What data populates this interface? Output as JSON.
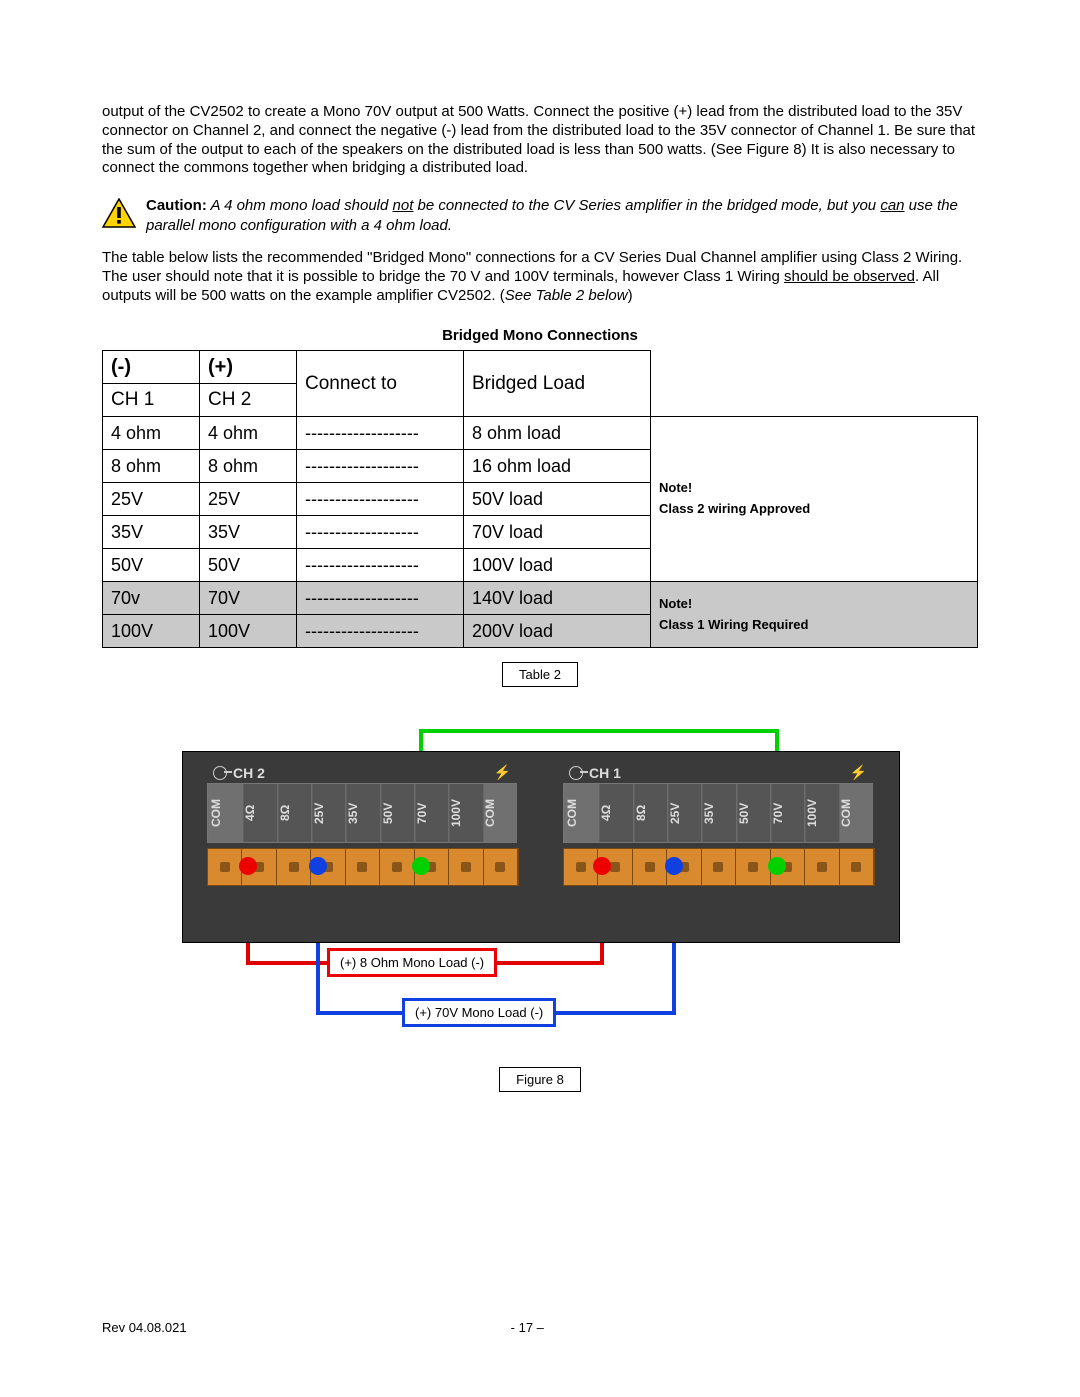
{
  "para1": "output of the CV2502 to create a Mono 70V output at 500 Watts.  Connect the positive (+) lead from the distributed load to the 35V connector on Channel 2, and connect the negative (-) lead from the distributed load to the 35V connector of Channel 1. Be sure that the sum of the output to each of the speakers on the distributed load is less than 500 watts.  (See Figure 8)  It is also necessary to connect the commons together when bridging a distributed load.",
  "caution_label": "Caution:",
  "caution_body_1": "A 4 ohm mono load should ",
  "caution_not": "not",
  "caution_body_2": " be connected to the CV Series amplifier in the bridged mode, but you ",
  "caution_can": "can",
  "caution_body_3": " use the parallel mono configuration with a 4 ohm load.",
  "para2_a": "The table below lists the recommended \"Bridged Mono\" connections for a CV Series Dual Channel amplifier using Class 2 Wiring.  The user should note that it is possible to bridge the 70 V and 100V terminals, however Class 1 Wiring ",
  "para2_u": "should be observed",
  "para2_b": ".  All outputs will be 500 watts on the example amplifier CV2502. (",
  "para2_i": "See Table 2 below",
  "para2_c": ")",
  "table_title": "Bridged Mono Connections",
  "headers": {
    "neg": "(-)",
    "pos": "(+)",
    "ch1": "CH 1",
    "ch2": "CH 2",
    "connect": "Connect to",
    "load": "Bridged Load"
  },
  "rows": [
    {
      "ch1": "4 ohm",
      "ch2": "4 ohm",
      "conn": "-------------------",
      "load": "8 ohm load",
      "group": "c2"
    },
    {
      "ch1": "8 ohm",
      "ch2": "8 ohm",
      "conn": "-------------------",
      "load": "16 ohm load",
      "group": "c2"
    },
    {
      "ch1": "25V",
      "ch2": "25V",
      "conn": "-------------------",
      "load": "50V load",
      "group": "c2"
    },
    {
      "ch1": "35V",
      "ch2": "35V",
      "conn": "-------------------",
      "load": "70V load",
      "group": "c2"
    },
    {
      "ch1": "50V",
      "ch2": "50V",
      "conn": "-------------------",
      "load": "100V load",
      "group": "c2"
    },
    {
      "ch1": "70v",
      "ch2": "70V",
      "conn": "-------------------",
      "load": "140V load",
      "group": "c1"
    },
    {
      "ch1": "100V",
      "ch2": "100V",
      "conn": "-------------------",
      "load": "200V load",
      "group": "c1"
    }
  ],
  "note_c2_a": "Note!",
  "note_c2_b": "Class 2 wiring Approved",
  "note_c1_a": "Note!",
  "note_c1_b": "Class 1 Wiring Required",
  "caption_table": "Table 2",
  "caption_figure": "Figure 8",
  "figure": {
    "ch2_label": "CH 2",
    "ch1_label": "CH 1",
    "terminals": [
      "COM",
      "4Ω",
      "8Ω",
      "25V",
      "35V",
      "50V",
      "70V",
      "100V",
      "COM"
    ],
    "load_red": "(+) 8 Ohm Mono Load (-)",
    "load_blue": "(+) 70V Mono Load (-)"
  },
  "footer": {
    "rev": "Rev 04.08.021",
    "page": "- 17 –"
  }
}
